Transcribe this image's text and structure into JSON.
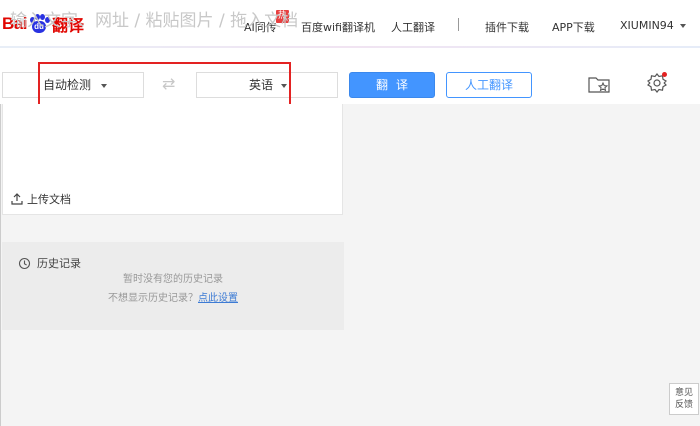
{
  "logo": {
    "brand": "Bai",
    "paw": "du",
    "product": "翻译"
  },
  "nav": {
    "ai_assistant": "AI同传",
    "hot_badge": "热",
    "wifi_machine": "百度wifi翻译机",
    "human_translation": "人工翻译",
    "plugin": "插件下载",
    "app": "APP下载",
    "user": "XIUMIN94"
  },
  "toolbar": {
    "source_lang": "自动检测",
    "target_lang": "英语",
    "translate_label": "翻译",
    "human_label": "人工翻译"
  },
  "input": {
    "placeholder": "输入文字、网址 / 粘贴图片 / 拖入文档",
    "upload_label": "上传文档"
  },
  "history": {
    "title": "历史记录",
    "empty": "暂时没有您的历史记录",
    "tip_prefix": "不想显示历史记录？",
    "tip_link": "点此设置"
  },
  "feedback": {
    "line1": "意见",
    "line2": "反馈"
  },
  "colors": {
    "brand_red": "#e10601",
    "brand_blue": "#2932e1",
    "accent": "#4395ff",
    "highlight": "#e32222"
  }
}
